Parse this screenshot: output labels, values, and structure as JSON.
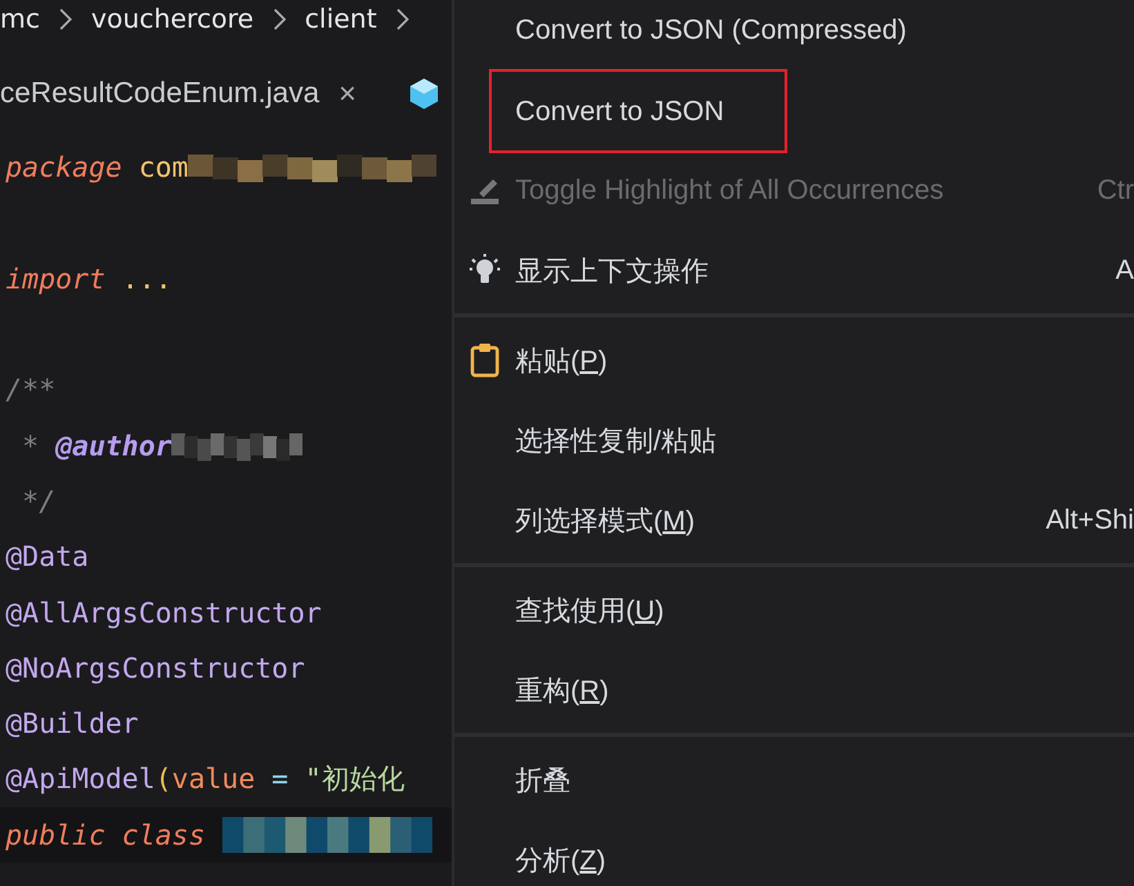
{
  "breadcrumb": [
    "mc",
    "vouchercore",
    "client"
  ],
  "editor_tab": {
    "label": "ceResultCodeEnum.java",
    "close": "×"
  },
  "code_lines": [
    {
      "kind": "code",
      "tokens": [
        {
          "kind": "keyword",
          "text": "package"
        },
        {
          "kind": "plain",
          "text": " com"
        }
      ],
      "redacted": true,
      "selected": false
    },
    {
      "kind": "blank"
    },
    {
      "kind": "code",
      "tokens": [
        {
          "kind": "keyword",
          "text": "import"
        },
        {
          "kind": "plain",
          "text": " ..."
        }
      ]
    },
    {
      "kind": "blank"
    },
    {
      "kind": "code",
      "tokens": [
        {
          "kind": "comment",
          "text": "/**"
        }
      ]
    },
    {
      "kind": "code",
      "tokens": [
        {
          "kind": "comment",
          "text": " * "
        },
        {
          "kind": "doctag",
          "text": "@author"
        }
      ],
      "redacted": true,
      "selected": false
    },
    {
      "kind": "code",
      "tokens": [
        {
          "kind": "comment",
          "text": " */"
        }
      ]
    },
    {
      "kind": "code",
      "tokens": [
        {
          "kind": "annotation",
          "text": "@Data"
        }
      ]
    },
    {
      "kind": "code",
      "tokens": [
        {
          "kind": "annotation",
          "text": "@AllArgsConstructor"
        }
      ]
    },
    {
      "kind": "code",
      "tokens": [
        {
          "kind": "annotation",
          "text": "@NoArgsConstructor"
        }
      ]
    },
    {
      "kind": "code",
      "tokens": [
        {
          "kind": "annotation",
          "text": "@Builder"
        }
      ]
    },
    {
      "kind": "code",
      "tokens": [
        {
          "kind": "annotation",
          "text": "@ApiModel"
        },
        {
          "kind": "paren",
          "text": "("
        },
        {
          "kind": "param",
          "text": "value"
        },
        {
          "kind": "operator",
          "text": " = "
        },
        {
          "kind": "string",
          "text": "\"初始化"
        }
      ]
    },
    {
      "kind": "code",
      "tokens": [
        {
          "kind": "keyword",
          "text": "public class "
        }
      ],
      "redacted": true,
      "selected": true
    }
  ],
  "context_menu": [
    {
      "kind": "item",
      "before": "Convert to JSON (Compressed)",
      "disabled": false,
      "highlighted": false
    },
    {
      "kind": "item",
      "before": "Convert to JSON",
      "disabled": false,
      "highlighted": true
    },
    {
      "kind": "item",
      "before": "Toggle Highlight of All Occurrences",
      "shortcut": "Ctr",
      "disabled": true,
      "highlighted": false
    },
    {
      "kind": "item",
      "before": "显示上下文操作",
      "shortcut": "A",
      "disabled": false,
      "highlighted": false
    },
    {
      "kind": "separator"
    },
    {
      "kind": "item",
      "before": "粘贴(",
      "mnemonic": "P",
      "after": ")",
      "disabled": false,
      "highlighted": false
    },
    {
      "kind": "item",
      "before": "选择性复制/粘贴",
      "disabled": false,
      "highlighted": false
    },
    {
      "kind": "item",
      "before": "列选择模式(",
      "mnemonic": "M",
      "after": ")",
      "shortcut": "Alt+Shi",
      "disabled": false,
      "highlighted": false
    },
    {
      "kind": "separator"
    },
    {
      "kind": "item",
      "before": "查找使用(",
      "mnemonic": "U",
      "after": ")",
      "disabled": false,
      "highlighted": false
    },
    {
      "kind": "item",
      "before": "重构(",
      "mnemonic": "R",
      "after": ")",
      "disabled": false,
      "highlighted": false
    },
    {
      "kind": "separator"
    },
    {
      "kind": "item",
      "before": "折叠",
      "disabled": false,
      "highlighted": false
    },
    {
      "kind": "item",
      "before": "分析(",
      "mnemonic": "Z",
      "after": ")",
      "disabled": false,
      "highlighted": false
    }
  ]
}
